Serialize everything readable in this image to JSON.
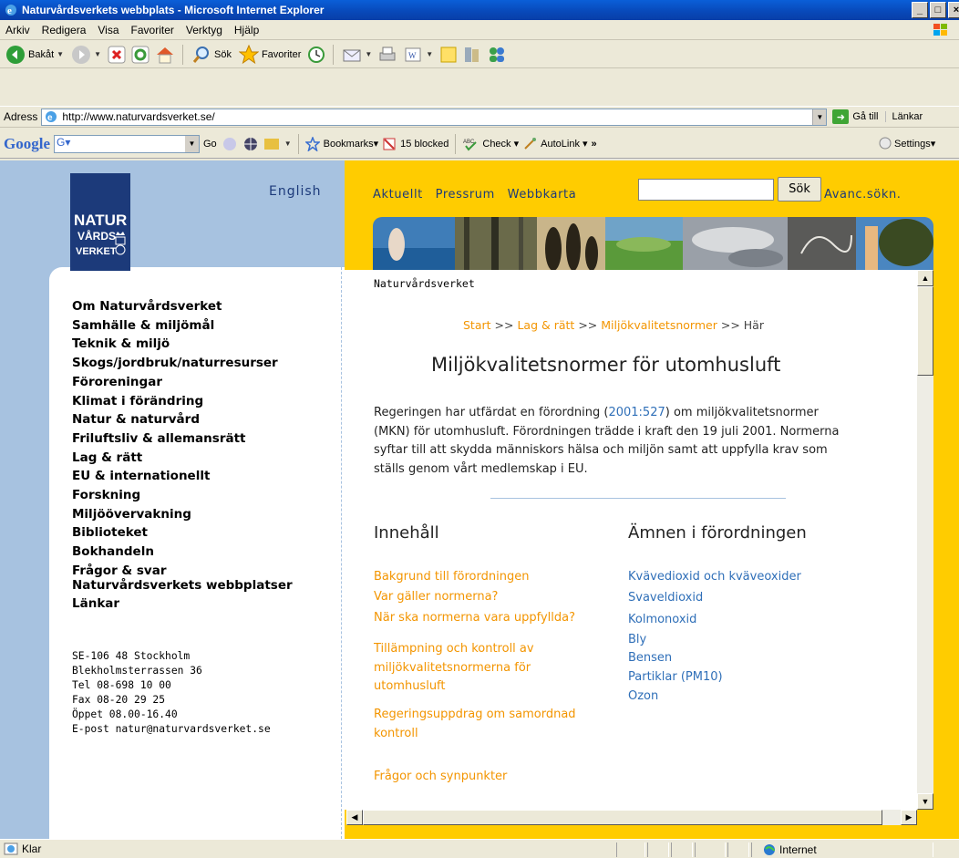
{
  "window": {
    "title": "Naturvårdsverkets webbplats - Microsoft Internet Explorer",
    "buttons": [
      "_",
      "□",
      "×"
    ]
  },
  "menubar": {
    "items": [
      "Arkiv",
      "Redigera",
      "Visa",
      "Favoriter",
      "Verktyg",
      "Hjälp"
    ]
  },
  "toolbar": {
    "back": "Bakåt",
    "search": "Sök",
    "favorites": "Favoriter"
  },
  "address": {
    "label": "Adress",
    "url": "http://www.naturvardsverket.se/",
    "go": "Gå till",
    "links": "Länkar"
  },
  "google": {
    "logo": "Google",
    "search_value": "G▾",
    "go": "Go",
    "bookmarks": "Bookmarks▾",
    "blocked": "15 blocked",
    "check": "Check ▾",
    "autolink": "AutoLink ▾",
    "more": "»",
    "settings": "Settings▾"
  },
  "site": {
    "english": "English",
    "logo": {
      "line1": "NATUR",
      "line2": "VÅRDS",
      "line3": "VERKET"
    },
    "topnav": [
      "Aktuellt",
      "Pressrum",
      "Webbkarta"
    ],
    "search": {
      "value": "",
      "button": "Sök",
      "advanced": "Avanc.sökn."
    },
    "leftnav": [
      "Om Naturvårdsverket",
      "Samhälle & miljömål",
      "Teknik & miljö",
      "Skogs/jordbruk/naturresurser",
      "Föroreningar",
      "Klimat i förändring",
      "Natur & naturvård",
      "Friluftsliv & allemansrätt",
      "Lag & rätt",
      "EU & internationellt",
      "Forskning",
      "Miljöövervakning",
      "Biblioteket",
      "Bokhandeln",
      "Frågor & svar",
      "Naturvårdsverkets webbplatser",
      "Länkar"
    ],
    "contact": [
      "SE-106 48 Stockholm",
      "Blekholmsterrassen 36",
      "Tel 08-698 10 00",
      "Fax 08-20 29 25",
      "Öppet 08.00-16.40",
      "E-post natur@naturvardsverket.se"
    ]
  },
  "content": {
    "crumbtop": "Naturvårdsverket",
    "breadcrumb": {
      "start": "Start",
      "sep": ">>",
      "lag": "Lag & rätt",
      "mkn": "Miljökvalitetsnormer",
      "here": "Här"
    },
    "title": "Miljökvalitetsnormer för utomhusluft",
    "intro_a": "Regeringen har utfärdat en förordning (",
    "intro_link": "2001:527",
    "intro_b": ") om miljökvalitetsnormer",
    "intro_c": "(MKN) för utomhusluft. Förordningen trädde i kraft den 19 juli 2001. Normerna",
    "intro_d": "syftar till att skydda människors hälsa och miljön samt att uppfylla krav som",
    "intro_e": "ställs genom vårt medlemskap i EU.",
    "innehall": {
      "heading": "Innehåll",
      "links": [
        [
          "Bakgrund till förordningen"
        ],
        [
          "Var gäller normerna?"
        ],
        [
          "När ska normerna vara uppfyllda?"
        ],
        [
          "Tillämpning och kontroll av",
          "miljökvalitetsnormerna för",
          "utomhusluft"
        ],
        [
          "Regeringsuppdrag om samordnad",
          "kontroll"
        ],
        [
          "Frågor och synpunkter"
        ]
      ]
    },
    "amnen": {
      "heading": "Ämnen i förordningen",
      "links": [
        "Kvävedioxid och kväveoxider",
        "Svaveldioxid",
        "Kolmonoxid",
        "Bly",
        "Bensen",
        "Partiklar (PM10)",
        "Ozon"
      ]
    }
  },
  "status": {
    "text": "Klar",
    "zone": "Internet"
  },
  "colors": {
    "accent_orange": "#f39500",
    "link_blue": "#2f6fb8",
    "sidebar_blue": "#a7c2e0",
    "header_yellow": "#ffcc00",
    "logo_navy": "#1c3a7a"
  }
}
